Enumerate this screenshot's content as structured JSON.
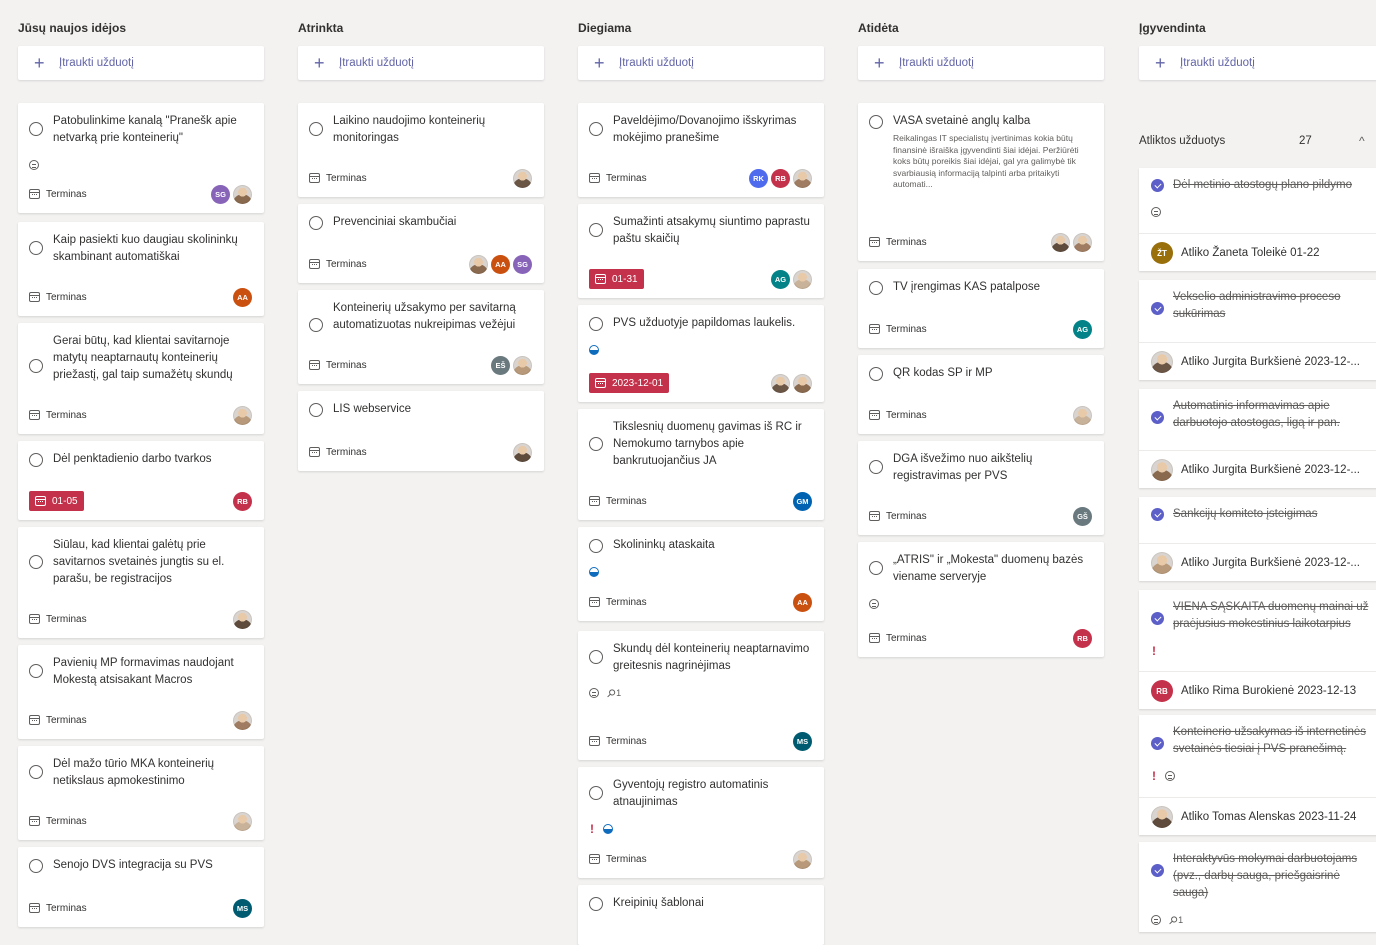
{
  "add_task_label": "Įtraukti užduotį",
  "termin_label": "Terminas",
  "colors": {
    "accent": "#6264a7",
    "late": "#c4314b",
    "progress": "#0f6cbd",
    "check": "#5b5fc7"
  },
  "buckets": [
    {
      "title": "Jūsų naujos idėjos",
      "cards": [
        {
          "title": "Patobulinkime kanalą \"Pranešk apie netvarką prie konteinerių\"",
          "icons": [
            "comment"
          ],
          "date": null,
          "avatars": [
            "SG",
            "photo"
          ]
        },
        {
          "title": "Kaip pasiekti kuo daugiau skolininkų skambinant automatiškai",
          "icons": [],
          "date": null,
          "avatars": [
            "AA"
          ]
        },
        {
          "title": "Gerai būtų, kad klientai savitarnoje matytų neaptarnautų konteinerių priežastį, gal taip sumažėtų skundų",
          "icons": [],
          "date": null,
          "avatars": [
            "photo"
          ]
        },
        {
          "title": "Dėl penktadienio darbo tvarkos",
          "icons": [],
          "date": "01-05",
          "avatars": [
            "RB"
          ]
        },
        {
          "title": "Siūlau, kad klientai galėtų prie savitarnos svetainės jungtis su el. parašu, be registracijos",
          "icons": [],
          "date": null,
          "avatars": [
            "photo"
          ]
        },
        {
          "title": "Pavienių MP formavimas naudojant Mokestą atsisakant Macros",
          "icons": [],
          "date": null,
          "avatars": [
            "photo"
          ]
        },
        {
          "title": "Dėl mažo tūrio MKA konteinerių netikslaus apmokestinimo",
          "icons": [],
          "date": null,
          "avatars": [
            "photo"
          ]
        },
        {
          "title": "Senojo DVS integracija su PVS",
          "icons": [],
          "date": null,
          "avatars": [
            "MS"
          ]
        }
      ]
    },
    {
      "title": "Atrinkta",
      "cards": [
        {
          "title": "Laikino naudojimo konteinerių monitoringas",
          "icons": [],
          "date": null,
          "avatars": [
            "photo"
          ]
        },
        {
          "title": "Prevenciniai skambučiai",
          "icons": [],
          "date": null,
          "avatars": [
            "photo",
            "AA",
            "SG"
          ]
        },
        {
          "title": "Konteinerių užsakymo per savitarną automatizuotas nukreipimas vežėjui",
          "icons": [],
          "date": null,
          "avatars": [
            "EŠ",
            "photo"
          ]
        },
        {
          "title": "LIS webservice",
          "icons": [],
          "date": null,
          "avatars": [
            "photo"
          ]
        }
      ]
    },
    {
      "title": "Diegiama",
      "cards": [
        {
          "title": "Paveldėjimo/Dovanojimo išskyrimas mokėjimo pranešime",
          "icons": [],
          "date": null,
          "avatars": [
            "RK",
            "RB",
            "photo"
          ]
        },
        {
          "title": "Sumažinti atsakymų siuntimo paprastu paštu skaičių",
          "icons": [],
          "date": "01-31",
          "avatars": [
            "AG",
            "photo"
          ]
        },
        {
          "title": "PVS užduotyje papildomas laukelis.",
          "icons": [
            "progress"
          ],
          "date": "2023-12-01",
          "avatars": [
            "photo",
            "photo"
          ]
        },
        {
          "title": "Tikslesnių duomenų gavimas iš RC ir Nemokumo tarnybos apie bankrutuojančius JA",
          "icons": [],
          "date": null,
          "avatars": [
            "GM"
          ]
        },
        {
          "title": "Skolininkų ataskaita",
          "icons": [
            "progress"
          ],
          "date": null,
          "avatars": [
            "AA"
          ]
        },
        {
          "title": "Skundų dėl konteinerių neaptarnavimo greitesnis nagrinėjimas",
          "icons": [
            "comment",
            "attach"
          ],
          "attach_count": "1",
          "date": null,
          "avatars": [
            "MS"
          ]
        },
        {
          "title": "Gyventojų registro automatinis atnaujinimas",
          "icons": [
            "urgent",
            "progress"
          ],
          "date": null,
          "avatars": [
            "photo"
          ]
        },
        {
          "title": "Kreipinių šablonai",
          "icons": [],
          "date": null,
          "avatars": []
        }
      ]
    },
    {
      "title": "Atidėta",
      "cards": [
        {
          "title": "VASA svetainė anglų kalba",
          "desc": "Reikalingas IT specialistų įvertinimas kokia būtų finansinė išraiška įgyvendinti šiai idėjai. Peržiūrėti koks būtų poreikis šiai idėjai, gal yra galimybė tik svarbiausią informaciją talpinti arba pritaikyti automati...",
          "icons": [],
          "date": null,
          "avatars": [
            "photo",
            "photo"
          ]
        },
        {
          "title": "TV įrengimas KAS patalpose",
          "icons": [],
          "date": null,
          "avatars": [
            "AG"
          ]
        },
        {
          "title": "QR kodas SP ir MP",
          "icons": [],
          "date": null,
          "avatars": [
            "photo"
          ]
        },
        {
          "title": "DGA išvežimo nuo aikštelių registravimas per PVS",
          "icons": [],
          "date": null,
          "avatars": [
            "GŠ"
          ]
        },
        {
          "title": "„ATRIS\" ir „Mokesta\" duomenų bazės viename serveryje",
          "icons": [
            "comment"
          ],
          "date": null,
          "avatars": [
            "RB"
          ]
        }
      ]
    },
    {
      "title": "Įgyvendinta",
      "cards": []
    }
  ],
  "completed": {
    "label": "Atliktos užduotys",
    "count": "27",
    "items": [
      {
        "title": "Dėl metinio atostogų plano pildymo",
        "icons": [
          "comment"
        ],
        "who": "Atliko Žaneta Toleikė 01-22",
        "avatar": "ŽT"
      },
      {
        "title": "Vekselio administravimo proceso sukūrimas",
        "icons": [],
        "who": "Atliko Jurgita Burkšienė 2023-12-...",
        "avatar": "photo"
      },
      {
        "title": "Automatinis informavimas apie darbuotojo atostogas, ligą ir pan.",
        "icons": [],
        "who": "Atliko Jurgita Burkšienė 2023-12-...",
        "avatar": "photo"
      },
      {
        "title": "Sankcijų komiteto įsteigimas",
        "icons": [],
        "who": "Atliko Jurgita Burkšienė 2023-12-...",
        "avatar": "photo"
      },
      {
        "title": "VIENA SĄSKAITA duomenų mainai už praėjusius mokestinius laikotarpius",
        "icons": [
          "urgent"
        ],
        "who": "Atliko Rima Burokienė 2023-12-13",
        "avatar": "RB"
      },
      {
        "title": "Konteinerio užsakymas iš internetinės svetainės tiesiai į PVS pranešimą.",
        "icons": [
          "urgent",
          "comment"
        ],
        "who": "Atliko Tomas Alenskas 2023-11-24",
        "avatar": "photo"
      },
      {
        "title": "Interaktyvūs mokymai darbuotojams (pvz., darbų sauga, priešgaisrinė sauga)",
        "icons": [
          "comment",
          "attach"
        ],
        "attach_count": "1",
        "who": "",
        "avatar": ""
      }
    ]
  }
}
